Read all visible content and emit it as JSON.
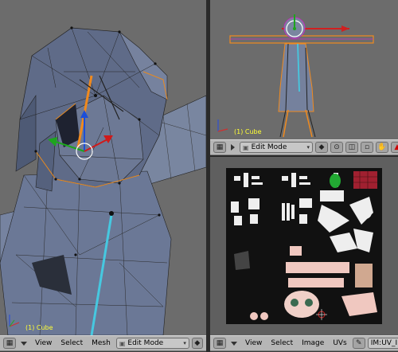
{
  "viewports": {
    "main": {
      "object_label": "(1) Cube"
    },
    "top_right": {
      "object_label": "(1) Cube"
    }
  },
  "main_header": {
    "menus": [
      "View",
      "Select",
      "Mesh"
    ],
    "mode": "Edit Mode"
  },
  "tr_header": {
    "mode": "Edit Mode"
  },
  "uv_header": {
    "menus": [
      "View",
      "Select",
      "Image",
      "UVs"
    ],
    "image_name": "IM:UV_I"
  },
  "colors": {
    "viewport_bg": "#6c6c6c",
    "mesh_fill": "#6f7a92",
    "header_bg": "#b6b6b6",
    "bone_orange": "#f08a1e",
    "bone_cyan": "#46c8e0"
  },
  "icons": [
    "view-grid-icon",
    "cursor-icon",
    "lock-icon",
    "snap-icon",
    "hand-icon",
    "warning-icon",
    "pin-icon"
  ]
}
